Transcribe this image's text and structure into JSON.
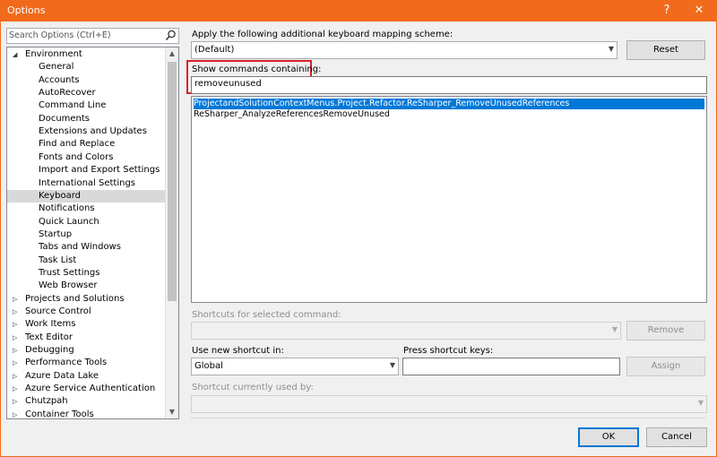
{
  "window": {
    "title": "Options",
    "help_glyph": "?",
    "close_glyph": "✕"
  },
  "search": {
    "placeholder": "Search Options (Ctrl+E)",
    "icon": "search-icon"
  },
  "tree": {
    "environment": {
      "label": "Environment",
      "children": [
        "General",
        "Accounts",
        "AutoRecover",
        "Command Line",
        "Documents",
        "Extensions and Updates",
        "Find and Replace",
        "Fonts and Colors",
        "Import and Export Settings",
        "International Settings",
        "Keyboard",
        "Notifications",
        "Quick Launch",
        "Startup",
        "Tabs and Windows",
        "Task List",
        "Trust Settings",
        "Web Browser"
      ],
      "selected": "Keyboard"
    },
    "collapsed": [
      "Projects and Solutions",
      "Source Control",
      "Work Items",
      "Text Editor",
      "Debugging",
      "Performance Tools",
      "Azure Data Lake",
      "Azure Service Authentication",
      "Chutzpah",
      "Container Tools"
    ]
  },
  "main": {
    "mapping_label": "Apply the following additional keyboard mapping scheme:",
    "mapping_value": "(Default)",
    "reset_label": "Reset",
    "show_commands_label": "Show commands containing:",
    "show_commands_value": "removeunused",
    "commands": [
      "ProjectandSolutionContextMenus.Project.Refactor.ReSharper_RemoveUnusedReferences",
      "ReSharper_AnalyzeReferencesRemoveUnused"
    ],
    "shortcuts_label": "Shortcuts for selected command:",
    "remove_label": "Remove",
    "use_new_label": "Use new shortcut in:",
    "use_new_value": "Global",
    "press_keys_label": "Press shortcut keys:",
    "assign_label": "Assign",
    "currently_used_label": "Shortcut currently used by:"
  },
  "footer": {
    "ok_label": "OK",
    "cancel_label": "Cancel"
  },
  "colors": {
    "titlebar": "#f26a1b",
    "selection": "#0078d7",
    "highlight_box": "#d8232a"
  }
}
